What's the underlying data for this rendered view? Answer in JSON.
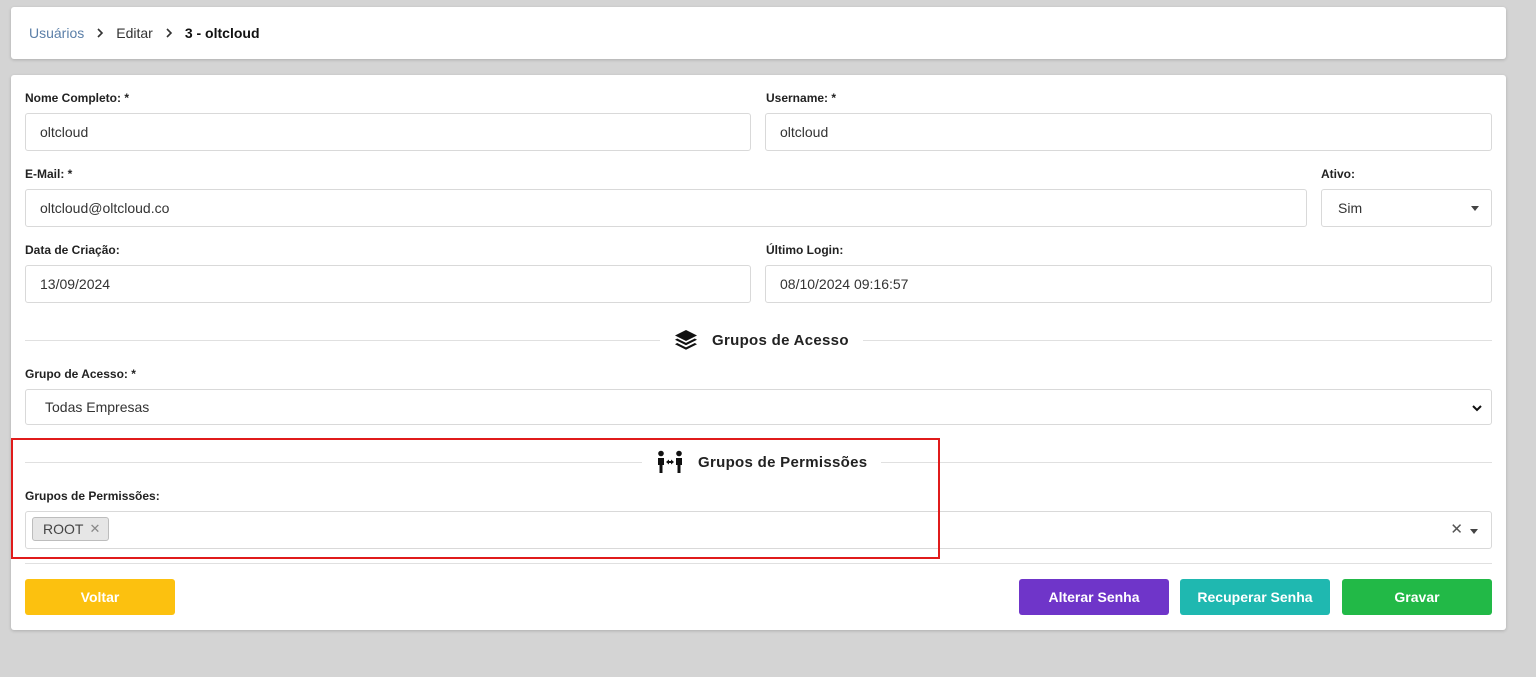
{
  "breadcrumb": {
    "root": "Usuários",
    "middle": "Editar",
    "current": "3 - oltcloud"
  },
  "form": {
    "nome_label": "Nome Completo: *",
    "nome_value": "oltcloud",
    "username_label": "Username: *",
    "username_value": "oltcloud",
    "email_label": "E-Mail: *",
    "email_value": "oltcloud@oltcloud.co",
    "ativo_label": "Ativo:",
    "ativo_value": "Sim",
    "criacao_label": "Data de Criação:",
    "criacao_value": "13/09/2024",
    "login_label": "Último Login:",
    "login_value": "08/10/2024 09:16:57"
  },
  "sections": {
    "acesso_title": "Grupos de Acesso",
    "acesso_icon": "layers-icon",
    "permissoes_title": "Grupos de Permissões",
    "permissoes_icon": "people-arrows-icon"
  },
  "grupo_acesso": {
    "label": "Grupo de Acesso: *",
    "value": "Todas Empresas"
  },
  "grupo_permissoes": {
    "label": "Grupos de Permissões:",
    "tags": [
      "ROOT"
    ]
  },
  "buttons": {
    "voltar": "Voltar",
    "alterar_senha": "Alterar Senha",
    "recuperar_senha": "Recuperar Senha",
    "gravar": "Gravar"
  },
  "colors": {
    "voltar": "#fcc10f",
    "alterar_senha": "#6f35c9",
    "recuperar_senha": "#1fb8b0",
    "gravar": "#22b947",
    "highlight": "#e01b1b",
    "breadcrumb_link": "#5b7fa8"
  }
}
